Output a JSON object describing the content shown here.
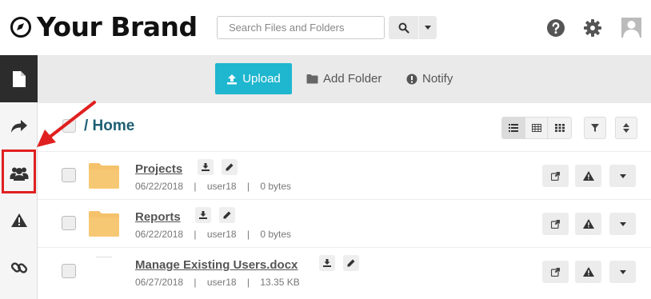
{
  "header": {
    "brand_name": "Your Brand",
    "search_placeholder": "Search Files and Folders",
    "icons": [
      "help-icon",
      "gear-icon",
      "user-avatar-icon"
    ]
  },
  "sidebar": {
    "items": [
      {
        "name": "files",
        "icon": "file-icon",
        "active": true
      },
      {
        "name": "shares",
        "icon": "share-icon",
        "active": false
      },
      {
        "name": "users",
        "icon": "users-icon",
        "active": false
      },
      {
        "name": "alerts",
        "icon": "warning-icon",
        "active": false
      },
      {
        "name": "links",
        "icon": "link-icon",
        "active": false
      }
    ]
  },
  "toolbar": {
    "upload_label": "Upload",
    "add_folder_label": "Add Folder",
    "notify_label": "Notify"
  },
  "content": {
    "breadcrumb": "/ Home",
    "rows": [
      {
        "name": "Projects",
        "date": "06/22/2018",
        "owner": "user18",
        "size": "0 bytes",
        "type": "folder"
      },
      {
        "name": "Reports",
        "date": "06/22/2018",
        "owner": "user18",
        "size": "0 bytes",
        "type": "folder"
      },
      {
        "name": "Manage Existing Users.docx",
        "date": "06/27/2018",
        "owner": "user18",
        "size": "13.35 KB",
        "type": "file"
      }
    ]
  },
  "colors": {
    "accent": "#1fb6cf",
    "breadcrumb": "#1f5f73",
    "annotation": "#e02020",
    "folder": "#f5c26b"
  }
}
